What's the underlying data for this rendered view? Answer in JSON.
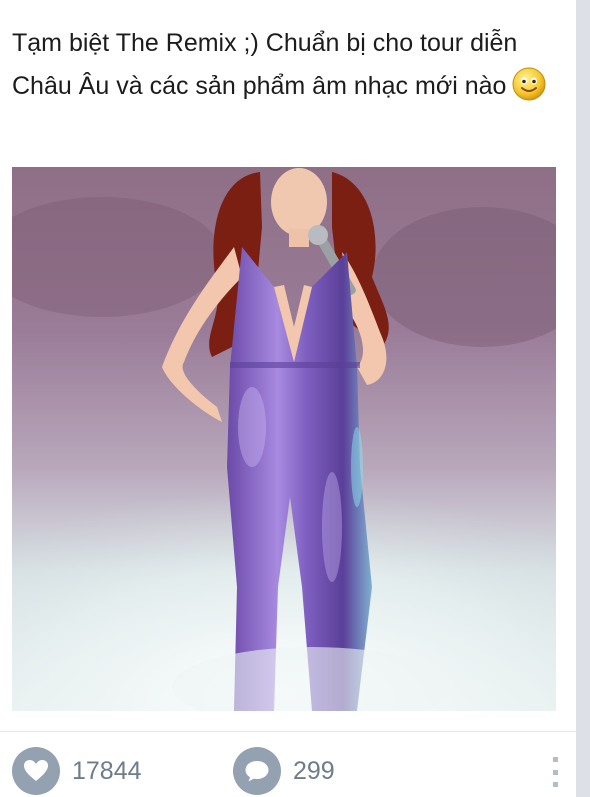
{
  "post": {
    "caption": "Tạm biệt The Remix ;) Chuẩn bị cho tour diễn Châu Âu và các sản phẩm âm nhạc mới nào",
    "emoji": "smiling-face-emoji"
  },
  "actions": {
    "like_icon": "heart-icon",
    "likes": "17844",
    "comment_icon": "comment-bubble-icon",
    "comments": "299",
    "more_icon": "more-vertical-icon"
  }
}
